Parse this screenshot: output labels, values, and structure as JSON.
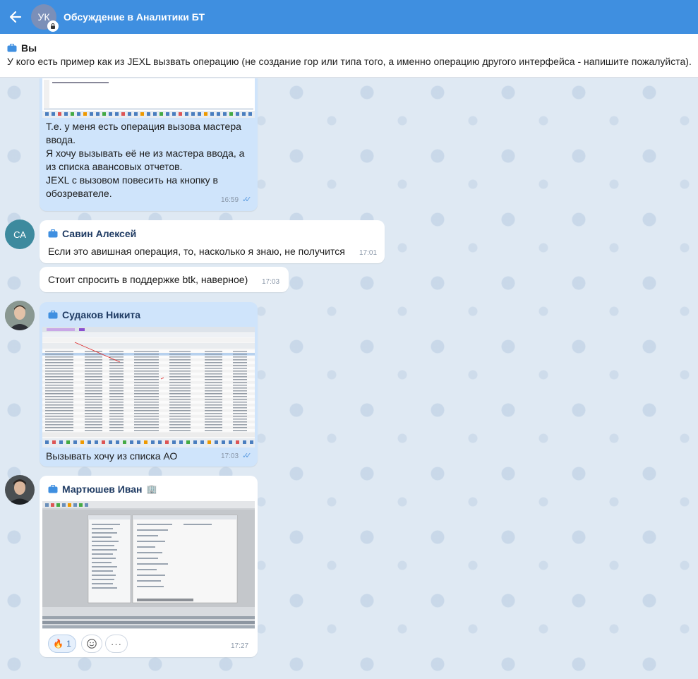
{
  "header": {
    "back_icon": "back-arrow-icon",
    "avatar_initials": "УК",
    "title": "Обсуждение в Аналитики БТ"
  },
  "pinned": {
    "name": "Вы",
    "text": "У кого есть пример как из JEXL вызвать операцию (не создание гор или типа того, а именно операцию другого интерфейса - напишите пожалуйста)."
  },
  "messages": {
    "m1": {
      "lines": [
        "Т.е. у меня есть операция вызова мастера",
        "ввода.",
        "Я хочу вызывать её не из мастера ввода, а",
        "из списка авансовых отчетов.",
        "JEXL с вызовом повесить на кнопку в",
        "обозревателе."
      ],
      "time": "16:59"
    },
    "m2": {
      "sender": "Савин Алексей",
      "avatar_initials": "СА",
      "text": "Если это авишная операция, то, насколько я знаю, не получится",
      "time": "17:01"
    },
    "m3": {
      "text": "Стоит спросить в поддержке btk, наверное)",
      "time": "17:03"
    },
    "m4": {
      "sender": "Судаков Никита",
      "text": "Вызывать хочу из списка АО",
      "time": "17:03"
    },
    "m5": {
      "sender": "Мартюшев Иван",
      "sender_badge": "🏢",
      "time": "17:27",
      "reaction_emoji": "🔥",
      "reaction_count": "1"
    }
  },
  "colors": {
    "header": "#3f8fe0",
    "own_bubble": "#cfe4fb",
    "other_bubble": "#ffffff",
    "sender_name": "#1f3b63",
    "check": "#5a9be0"
  }
}
